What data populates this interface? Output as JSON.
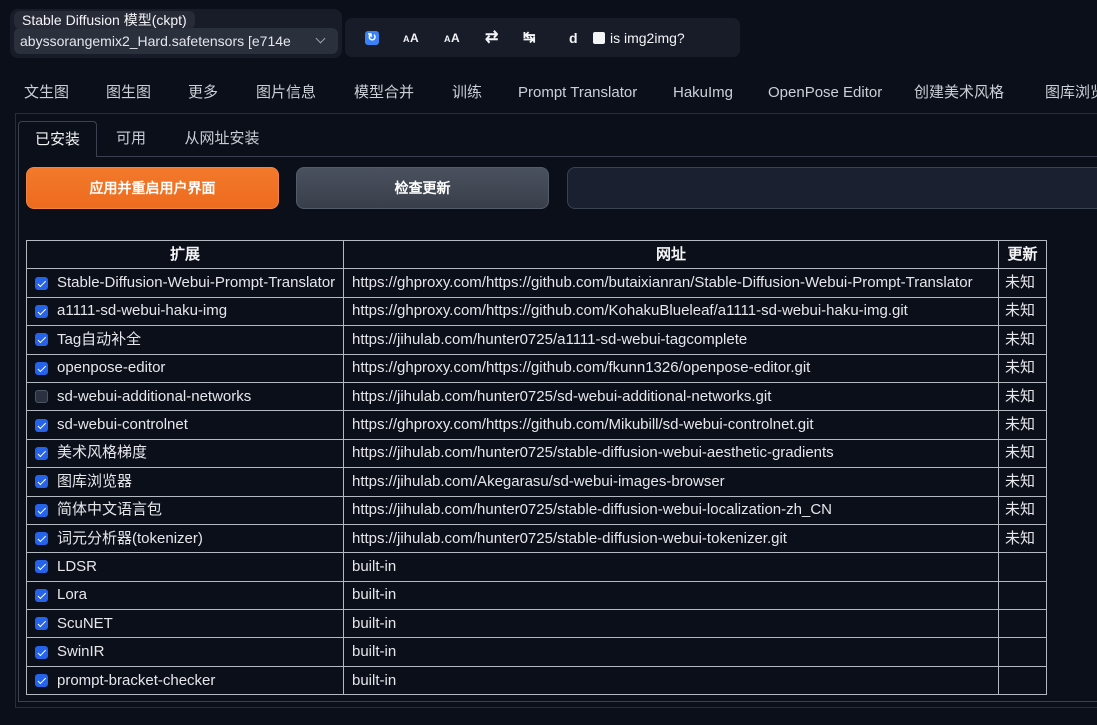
{
  "model_selector": {
    "label": "Stable Diffusion 模型(ckpt)",
    "value": "abyssorangemix2_Hard.safetensors [e714e",
    "chevron_icon": "chevron-down-icon"
  },
  "toolbar": {
    "buttons": [
      {
        "icon": "refresh-icon",
        "glyph": "↻"
      },
      {
        "icon": "font-size-icon",
        "glyph": "AA"
      },
      {
        "icon": "font-size-alt-icon",
        "glyph": "AA"
      },
      {
        "icon": "swap-icon",
        "glyph": "⇄"
      },
      {
        "icon": "tab-arrows-icon",
        "glyph": "↹"
      },
      {
        "icon": "d-button",
        "glyph": "d"
      }
    ],
    "img2img_checkbox": {
      "label": "is img2img?",
      "checked": false
    }
  },
  "main_tabs": [
    "文生图",
    "图生图",
    "更多",
    "图片信息",
    "模型合并",
    "训练",
    "Prompt Translator",
    "HakuImg",
    "OpenPose Editor",
    "创建美术风格",
    "图库浏览"
  ],
  "extensions": {
    "sub_tabs": [
      {
        "label": "已安装",
        "selected": true
      },
      {
        "label": "可用",
        "selected": false
      },
      {
        "label": "从网址安装",
        "selected": false
      }
    ],
    "apply_button": "应用并重启用户界面",
    "check_button": "检查更新",
    "table": {
      "headers": [
        "扩展",
        "网址",
        "更新"
      ],
      "rows": [
        {
          "name": "Stable-Diffusion-Webui-Prompt-Translator",
          "url": "https://ghproxy.com/https://github.com/butaixianran/Stable-Diffusion-Webui-Prompt-Translator",
          "update": "未知",
          "enabled": true
        },
        {
          "name": "a1111-sd-webui-haku-img",
          "url": "https://ghproxy.com/https://github.com/KohakuBlueleaf/a1111-sd-webui-haku-img.git",
          "update": "未知",
          "enabled": true
        },
        {
          "name": "Tag自动补全",
          "url": "https://jihulab.com/hunter0725/a1111-sd-webui-tagcomplete",
          "update": "未知",
          "enabled": true
        },
        {
          "name": "openpose-editor",
          "url": "https://ghproxy.com/https://github.com/fkunn1326/openpose-editor.git",
          "update": "未知",
          "enabled": true
        },
        {
          "name": "sd-webui-additional-networks",
          "url": "https://jihulab.com/hunter0725/sd-webui-additional-networks.git",
          "update": "未知",
          "enabled": false
        },
        {
          "name": "sd-webui-controlnet",
          "url": "https://ghproxy.com/https://github.com/Mikubill/sd-webui-controlnet.git",
          "update": "未知",
          "enabled": true
        },
        {
          "name": "美术风格梯度",
          "url": "https://jihulab.com/hunter0725/stable-diffusion-webui-aesthetic-gradients",
          "update": "未知",
          "enabled": true
        },
        {
          "name": "图库浏览器",
          "url": "https://jihulab.com/Akegarasu/sd-webui-images-browser",
          "update": "未知",
          "enabled": true
        },
        {
          "name": "简体中文语言包",
          "url": "https://jihulab.com/hunter0725/stable-diffusion-webui-localization-zh_CN",
          "update": "未知",
          "enabled": true
        },
        {
          "name": "词元分析器(tokenizer)",
          "url": "https://jihulab.com/hunter0725/stable-diffusion-webui-tokenizer.git",
          "update": "未知",
          "enabled": true
        },
        {
          "name": "LDSR",
          "url": "built-in",
          "enabled": true
        },
        {
          "name": "Lora",
          "url": "built-in",
          "enabled": true
        },
        {
          "name": "ScuNET",
          "url": "built-in",
          "enabled": true
        },
        {
          "name": "SwinIR",
          "url": "built-in",
          "enabled": true
        },
        {
          "name": "prompt-bracket-checker",
          "url": "built-in",
          "enabled": true
        }
      ]
    }
  },
  "colors": {
    "background": "#0b0f19",
    "apply_button_orange": "#ee6b1f",
    "checkbox_blue": "#2563eb",
    "refresh_icon_blue": "#3b82f6"
  }
}
